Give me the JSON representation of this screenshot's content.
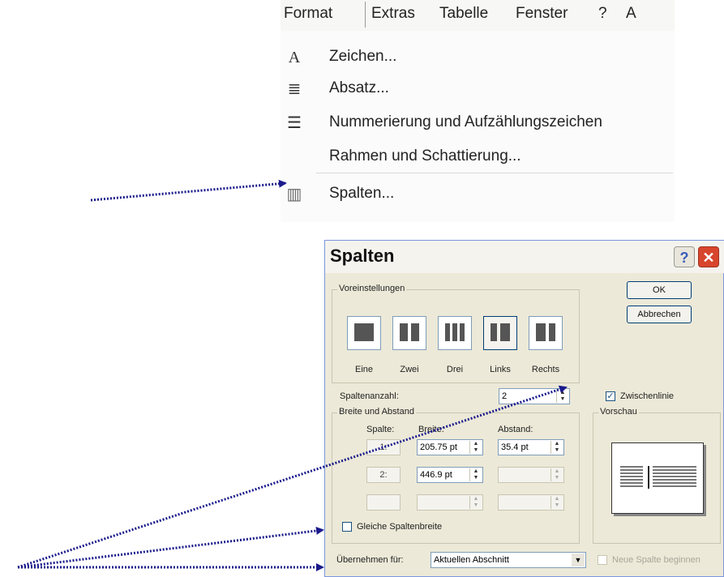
{
  "menubar": {
    "items": [
      "Format",
      "Extras",
      "Tabelle",
      "Fenster",
      "?",
      "A"
    ]
  },
  "menu": {
    "items": [
      {
        "label": "Zeichen...",
        "icon": "A"
      },
      {
        "label": "Absatz...",
        "icon": "≣"
      },
      {
        "label": "Nummerierung und Aufzählungszeichen",
        "icon": "☰"
      },
      {
        "label": "Rahmen und Schattierung...",
        "icon": ""
      },
      {
        "label": "Spalten...",
        "icon": "▥"
      }
    ]
  },
  "dialog": {
    "title": "Spalten",
    "help_label": "?",
    "close_label": "✕",
    "presets_group": "Voreinstellungen",
    "presets": [
      "Eine",
      "Zwei",
      "Drei",
      "Links",
      "Rechts"
    ],
    "ok_label": "OK",
    "cancel_label": "Abbrechen",
    "count_label": "Spaltenanzahl:",
    "count_value": "2",
    "line_between_label": "Zwischenlinie",
    "line_between_checked": "✓",
    "width_group": "Breite und Abstand",
    "col_header": "Spalte:",
    "width_header": "Breite:",
    "spacing_header": "Abstand:",
    "rows": [
      {
        "num": "1:",
        "width": "205.75 pt",
        "spacing": "35.4 pt"
      },
      {
        "num": "2:",
        "width": "446.9 pt",
        "spacing": ""
      },
      {
        "num": "",
        "width": "",
        "spacing": ""
      }
    ],
    "equal_width_label": "Gleiche Spaltenbreite",
    "preview_group": "Vorschau",
    "apply_label": "Übernehmen für:",
    "apply_value": "Aktuellen Abschnitt",
    "new_column_label": "Neue Spalte beginnen"
  },
  "colors": {
    "arrow": "#1a1a8c",
    "dialog_bg": "#ece9d8",
    "close_red": "#d7452c"
  }
}
